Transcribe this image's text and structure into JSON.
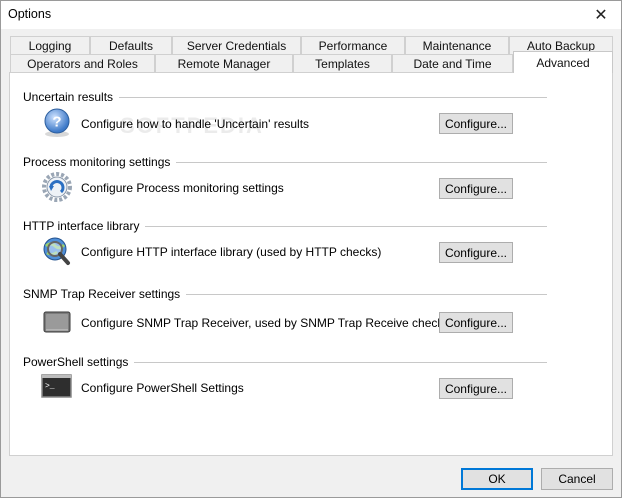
{
  "window": {
    "title": "Options"
  },
  "tabs_back": [
    {
      "label": "Logging"
    },
    {
      "label": "Defaults"
    },
    {
      "label": "Server Credentials"
    },
    {
      "label": "Performance"
    },
    {
      "label": "Maintenance"
    },
    {
      "label": "Auto Backup"
    }
  ],
  "tabs_front": [
    {
      "label": "Operators and Roles"
    },
    {
      "label": "Remote Manager"
    },
    {
      "label": "Templates"
    },
    {
      "label": "Date and Time"
    },
    {
      "label": "Advanced"
    }
  ],
  "active_tab": "Advanced",
  "groups": [
    {
      "title": "Uncertain results",
      "description": "Configure how to handle 'Uncertain' results",
      "button": "Configure...",
      "icon": "question-icon"
    },
    {
      "title": "Process monitoring settings",
      "description": "Configure Process monitoring settings",
      "button": "Configure...",
      "icon": "process-gear-icon"
    },
    {
      "title": "HTTP interface library",
      "description": "Configure HTTP interface library (used by HTTP checks)",
      "button": "Configure...",
      "icon": "globe-magnifier-icon"
    },
    {
      "title": "SNMP Trap Receiver settings",
      "description": "Configure SNMP Trap Receiver, used by SNMP Trap Receive checks",
      "button": "Configure...",
      "icon": "device-icon"
    },
    {
      "title": "PowerShell settings",
      "description": "Configure PowerShell Settings",
      "button": "Configure...",
      "icon": "terminal-icon"
    }
  ],
  "footer": {
    "ok": "OK",
    "cancel": "Cancel"
  },
  "colors": {
    "accent": "#0078d7",
    "button_bg": "#e1e1e1"
  }
}
